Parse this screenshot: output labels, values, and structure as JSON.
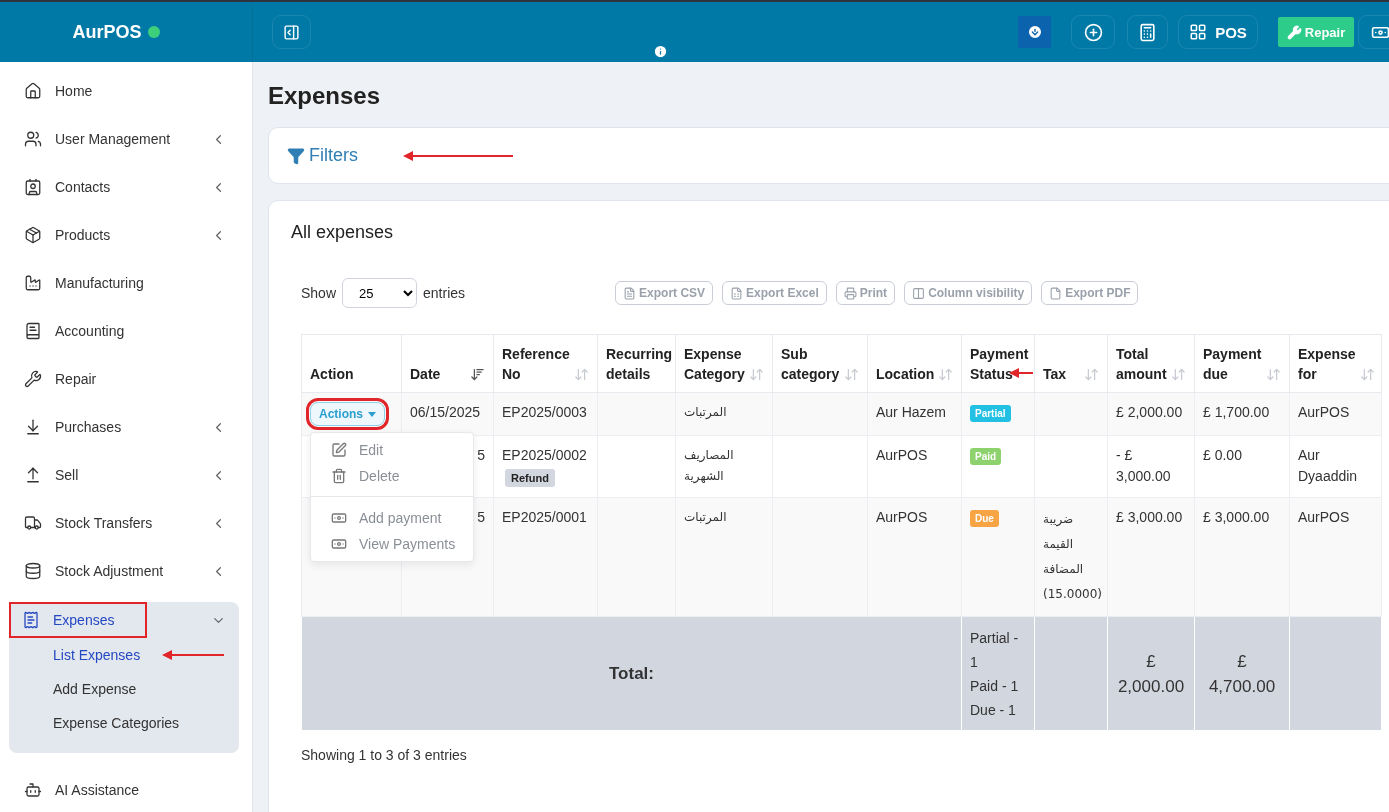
{
  "brand": {
    "name": "AurPOS",
    "online": true
  },
  "topbar": {
    "pos_label": "POS",
    "repair_label": "Repair"
  },
  "sidebar": {
    "items": [
      {
        "label": "Home",
        "has_submenu": false,
        "selected": false
      },
      {
        "label": "User Management",
        "has_submenu": true,
        "selected": false
      },
      {
        "label": "Contacts",
        "has_submenu": true,
        "selected": false
      },
      {
        "label": "Products",
        "has_submenu": true,
        "selected": false
      },
      {
        "label": "Manufacturing",
        "has_submenu": false,
        "selected": false
      },
      {
        "label": "Accounting",
        "has_submenu": false,
        "selected": false
      },
      {
        "label": "Repair",
        "has_submenu": false,
        "selected": false
      },
      {
        "label": "Purchases",
        "has_submenu": true,
        "selected": false
      },
      {
        "label": "Sell",
        "has_submenu": true,
        "selected": false
      },
      {
        "label": "Stock Transfers",
        "has_submenu": true,
        "selected": false
      },
      {
        "label": "Stock Adjustment",
        "has_submenu": true,
        "selected": false
      },
      {
        "label": "Expenses",
        "has_submenu": true,
        "selected": true,
        "expanded": true,
        "annotated": true,
        "children": [
          {
            "label": "List Expenses",
            "selected": true,
            "arrow": true
          },
          {
            "label": "Add Expense",
            "selected": false,
            "arrow": false
          },
          {
            "label": "Expense Categories",
            "selected": false,
            "arrow": false
          }
        ]
      },
      {
        "label": "AI Assistance",
        "has_submenu": false,
        "selected": false
      }
    ]
  },
  "page": {
    "title": "Expenses"
  },
  "filters": {
    "label": "Filters",
    "arrow": true
  },
  "expenses_card": {
    "title": "All expenses",
    "show_label": "Show",
    "page_size": "25",
    "entries_label": "entries",
    "export_buttons": [
      "Export CSV",
      "Export Excel",
      "Print",
      "Column visibility",
      "Export PDF"
    ],
    "table": {
      "columns": [
        {
          "label": "Action",
          "sortable": false,
          "arrow": false
        },
        {
          "label": "Date",
          "sortable": true,
          "sorted": true,
          "arrow": false
        },
        {
          "label": "Reference No",
          "sortable": true,
          "sorted": false,
          "arrow": false
        },
        {
          "label": "Recurring details",
          "sortable": false,
          "arrow": false
        },
        {
          "label": "Expense Category",
          "sortable": true,
          "sorted": false,
          "arrow": false
        },
        {
          "label": "Sub category",
          "sortable": true,
          "sorted": false,
          "arrow": false
        },
        {
          "label": "Location",
          "sortable": true,
          "sorted": false,
          "arrow": false
        },
        {
          "label": "Payment Status",
          "sortable": false,
          "arrow": true
        },
        {
          "label": "Tax",
          "sortable": true,
          "sorted": false,
          "arrow": false
        },
        {
          "label": "Total amount",
          "sortable": true,
          "sorted": false,
          "arrow": false
        },
        {
          "label": "Payment due",
          "sortable": true,
          "sorted": false,
          "arrow": false
        },
        {
          "label": "Expense for",
          "sortable": true,
          "sorted": false,
          "arrow": false
        }
      ],
      "rows": [
        {
          "action": "Actions",
          "action_annotated": true,
          "date": "06/15/2025",
          "reference_no": "EP2025/0003",
          "expense_category": "المرتبات",
          "location": "Aur Hazem",
          "payment_status": {
            "label": "Partial",
            "color": "#22c1e4"
          },
          "total_amount": "£ 2,000.00",
          "payment_due": "£ 1,700.00",
          "expense_for": "AurPOS"
        },
        {
          "date": "5",
          "reference_no": "EP2025/0002",
          "tag": "Refund",
          "expense_category": "المصاريف الشهرية",
          "location": "AurPOS",
          "payment_status": {
            "label": "Paid",
            "color": "#8ed26d"
          },
          "total_amount": "- £ 3,000.00",
          "payment_due": "£ 0.00",
          "expense_for": "Aur Dyaaddin"
        },
        {
          "date": "5",
          "reference_no": "EP2025/0001",
          "expense_category": "المرتبات",
          "location": "AurPOS",
          "payment_status": {
            "label": "Due",
            "color": "#f7a444"
          },
          "tax": "ضريبة القيمة المضافة (15.0000)",
          "total_amount": "£ 3,000.00",
          "payment_due": "£ 3,000.00",
          "expense_for": "AurPOS"
        }
      ],
      "total": {
        "label": "Total:",
        "status_counts": [
          "Partial - 1",
          "Paid - 1",
          "Due - 1"
        ],
        "total_amount": "£ 2,000.00",
        "payment_due": "£ 4,700.00"
      }
    },
    "info": "Showing 1 to 3 of 3 entries"
  },
  "actions_menu": {
    "groups": [
      [
        {
          "label": "Edit"
        },
        {
          "label": "Delete"
        }
      ],
      [
        {
          "label": "Add payment"
        },
        {
          "label": "View Payments"
        }
      ]
    ]
  }
}
